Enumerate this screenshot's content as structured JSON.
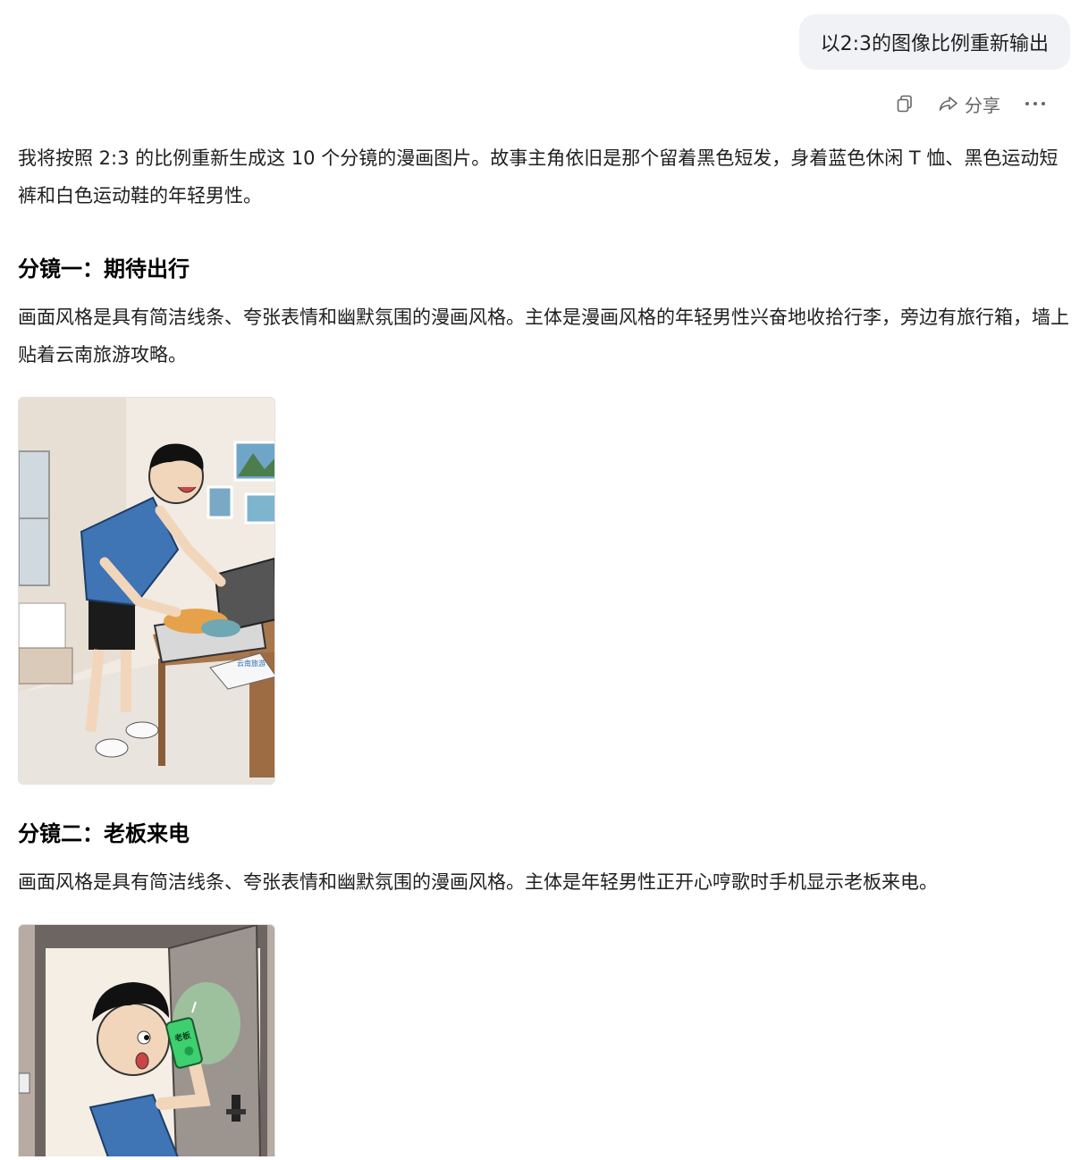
{
  "user_message": "以2:3的图像比例重新输出",
  "actions": {
    "copy_icon": "copy-icon",
    "share_label": "分享",
    "more_icon": "more-icon"
  },
  "reply": {
    "intro": "我将按照 2:3 的比例重新生成这 10 个分镜的漫画图片。故事主角依旧是那个留着黑色短发，身着蓝色休闲 T 恤、黑色运动短裤和白色运动鞋的年轻男性。",
    "panels": [
      {
        "heading": "分镜一：期待出行",
        "description": "画面风格是具有简洁线条、夸张表情和幽默氛围的漫画风格。主体是漫画风格的年轻男性兴奋地收拾行李，旁边有旅行箱，墙上贴着云南旅游攻略。",
        "image_icon": "comic-panel-packing-image",
        "image_text": "云南旅游"
      },
      {
        "heading": "分镜二：老板来电",
        "description": "画面风格是具有简洁线条、夸张表情和幽默氛围的漫画风格。主体是年轻男性正开心哼歌时手机显示老板来电。",
        "image_icon": "comic-panel-phone-call-image",
        "image_text": "老板"
      }
    ]
  },
  "colors": {
    "bubble_bg": "#f1f2f5",
    "shirt_blue": "#3f74b5",
    "phone_green": "#3ecf6e"
  }
}
